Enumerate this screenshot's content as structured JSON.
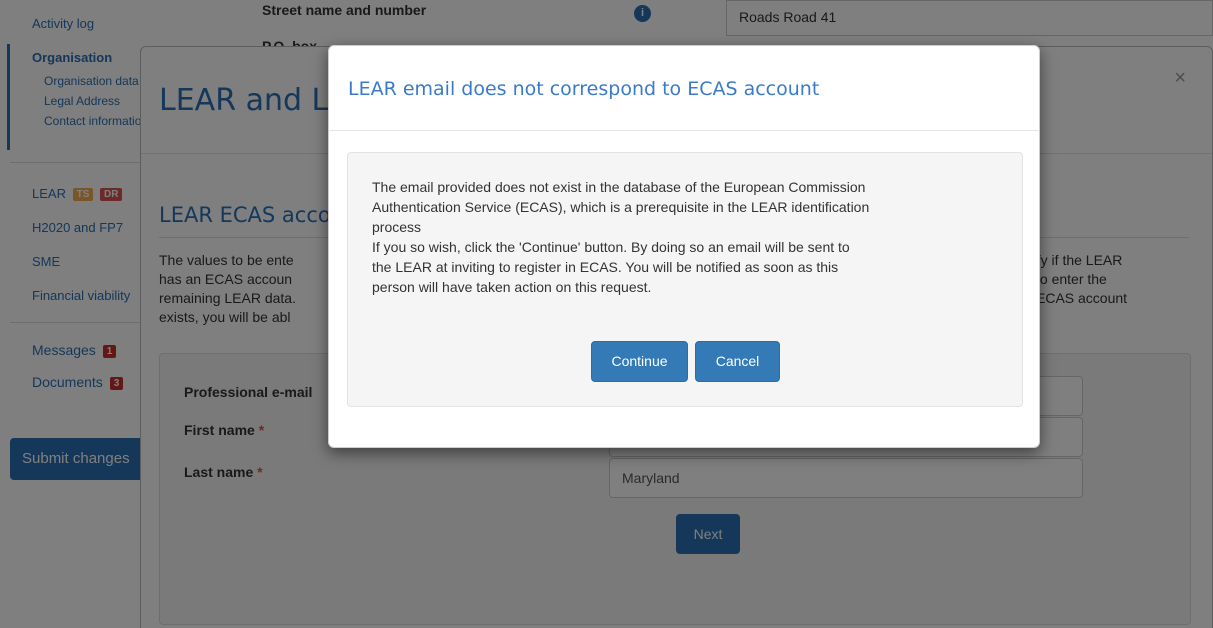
{
  "sidebar": {
    "activity_log": "Activity log",
    "organisation": "Organisation",
    "organisation_data": "Organisation data",
    "legal_address": "Legal Address",
    "contact_information": "Contact information",
    "lear": "LEAR",
    "lear_badge_ts": "TS",
    "lear_badge_dr": "DR",
    "h2020": "H2020 and FP7",
    "sme": "SME",
    "financial_viability": "Financial viability",
    "messages": "Messages",
    "messages_count": "1",
    "documents": "Documents",
    "documents_count": "3",
    "submit_changes": "Submit changes"
  },
  "background_table": {
    "street_label": "Street name and number",
    "street_value": "Roads Road 41",
    "po_label": "P.O. box"
  },
  "lear_modal": {
    "title": "LEAR and Legal",
    "close": "×",
    "subtitle": "LEAR ECAS account",
    "description": "The values to be entered are checked against ECAS to verify if the LEAR has an ECAS account. If the LEAR has an ECAS account, you will be able to enter the remaining LEAR data. If the LEAR has no ECAS account, or if no ECAS account exists, you will be able to invite the LEAR to create one.",
    "desc_line1_left": "The values to be ente",
    "desc_line1_right": "rify if the LEAR",
    "desc_line2_left": "has an ECAS accoun",
    "desc_line2_right": "to enter the",
    "desc_line3_left": "remaining LEAR data.",
    "desc_line3_right": "ECAS account",
    "desc_line4_left": "exists, you will be abl",
    "form": {
      "email_label": "Professional e-mail",
      "email_value": "",
      "first_name_label": "First name",
      "first_name_value": "",
      "last_name_label": "Last name",
      "last_name_value": "Maryland",
      "required_mark": "*",
      "next_label": "Next"
    }
  },
  "dialog": {
    "title": "LEAR email does not correspond to ECAS account",
    "line1": "The email provided does not exist in the database of the European Commission",
    "line2": "Authentication Service (ECAS), which is a prerequisite in the LEAR identification",
    "line3": "process",
    "line4": "If you so wish, click the 'Continue' button. By doing so an email will be sent to",
    "line5": "the LEAR at inviting to register in ECAS. You will be notified as soon as this",
    "line6": "person will have taken action on this request.",
    "continue_label": "Continue",
    "cancel_label": "Cancel"
  },
  "colors": {
    "primary": "#337ab7",
    "link": "#2a6fb5",
    "danger": "#d9534f",
    "warning": "#f0ad4e"
  }
}
